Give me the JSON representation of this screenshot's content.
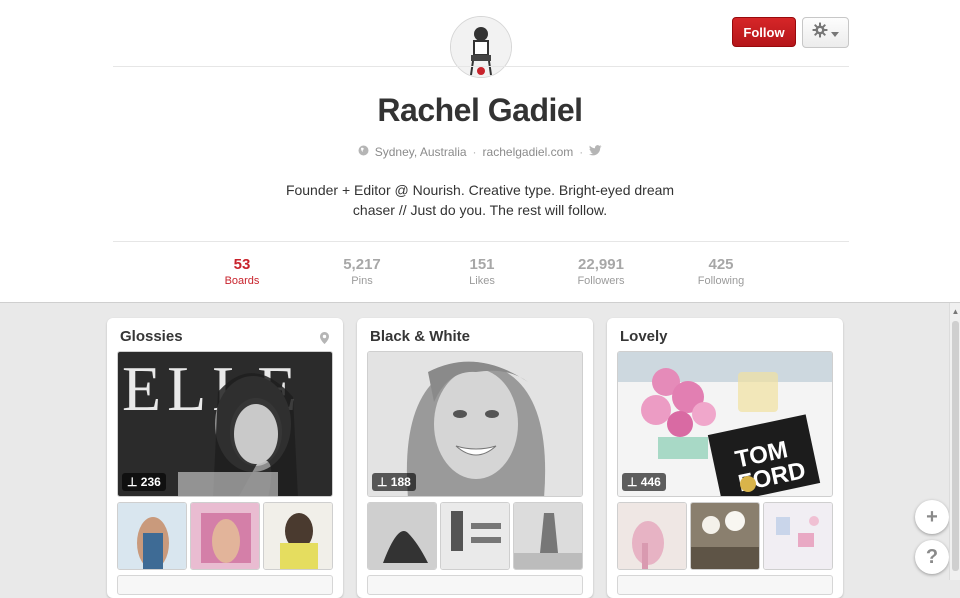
{
  "header": {
    "follow_label": "Follow",
    "settings_icon": "gear-icon"
  },
  "profile": {
    "name": "Rachel Gadiel",
    "location": "Sydney, Australia",
    "website": "rachelgadiel.com",
    "bio_line1": "Founder + Editor @ Nourish. Creative type. Bright-eyed dream",
    "bio_line2": "chaser // Just do you. The rest will follow.",
    "twitter_icon": "twitter-icon",
    "location_icon": "globe-icon"
  },
  "stats": [
    {
      "num": "53",
      "label": "Boards",
      "active": true
    },
    {
      "num": "5,217",
      "label": "Pins"
    },
    {
      "num": "151",
      "label": "Likes"
    },
    {
      "num": "22,991",
      "label": "Followers"
    },
    {
      "num": "425",
      "label": "Following"
    }
  ],
  "boards": [
    {
      "title": "Glossies",
      "pins": "236",
      "has_location": true
    },
    {
      "title": "Black & White",
      "pins": "188"
    },
    {
      "title": "Lovely",
      "pins": "446"
    }
  ],
  "colors": {
    "brand_red": "#c8232c",
    "background": "#e9e9e9"
  }
}
